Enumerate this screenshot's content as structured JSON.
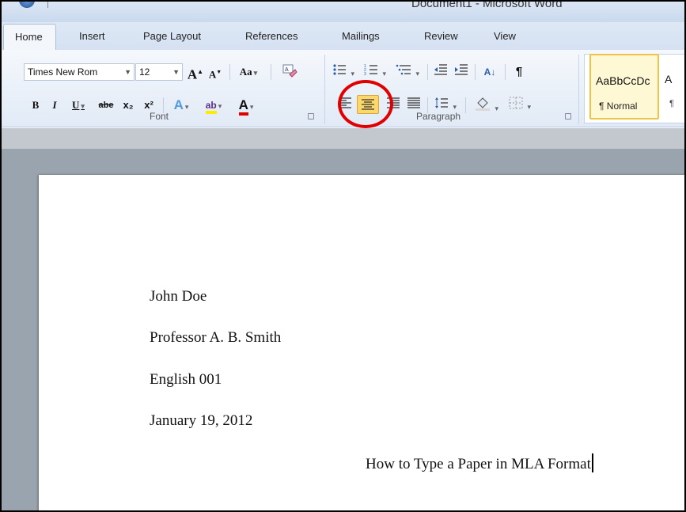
{
  "window": {
    "title": "Document1 - Microsoft Word"
  },
  "tabs": [
    "Home",
    "Insert",
    "Page Layout",
    "References",
    "Mailings",
    "Review",
    "View"
  ],
  "font_group": {
    "label": "Font",
    "font_name": "Times New Rom",
    "font_size": "12",
    "grow_font": "A",
    "shrink_font": "A",
    "change_case": "Aa",
    "bold": "B",
    "italic": "I",
    "underline": "U",
    "strikethrough": "abe",
    "subscript": "x₂",
    "superscript": "x²",
    "text_effects": "A",
    "highlight": "ab",
    "font_color": "A"
  },
  "paragraph_group": {
    "label": "Paragraph",
    "sort": "A↓",
    "show_marks": "¶"
  },
  "styles": {
    "preview_text": "AaBbCcDc",
    "normal_name": "¶ Normal",
    "next_preview": "A",
    "next_name": "¶"
  },
  "document": {
    "lines": [
      "John Doe",
      "Professor A. B. Smith",
      "English 001",
      "January 19, 2012"
    ],
    "title_line": "How to Type a Paper in MLA Format"
  },
  "colors": {
    "selected_button": "#fcd86a",
    "annotation_ring": "#e00000",
    "font_color_underline": "#e00000",
    "highlight_color": "#ffeb00"
  }
}
